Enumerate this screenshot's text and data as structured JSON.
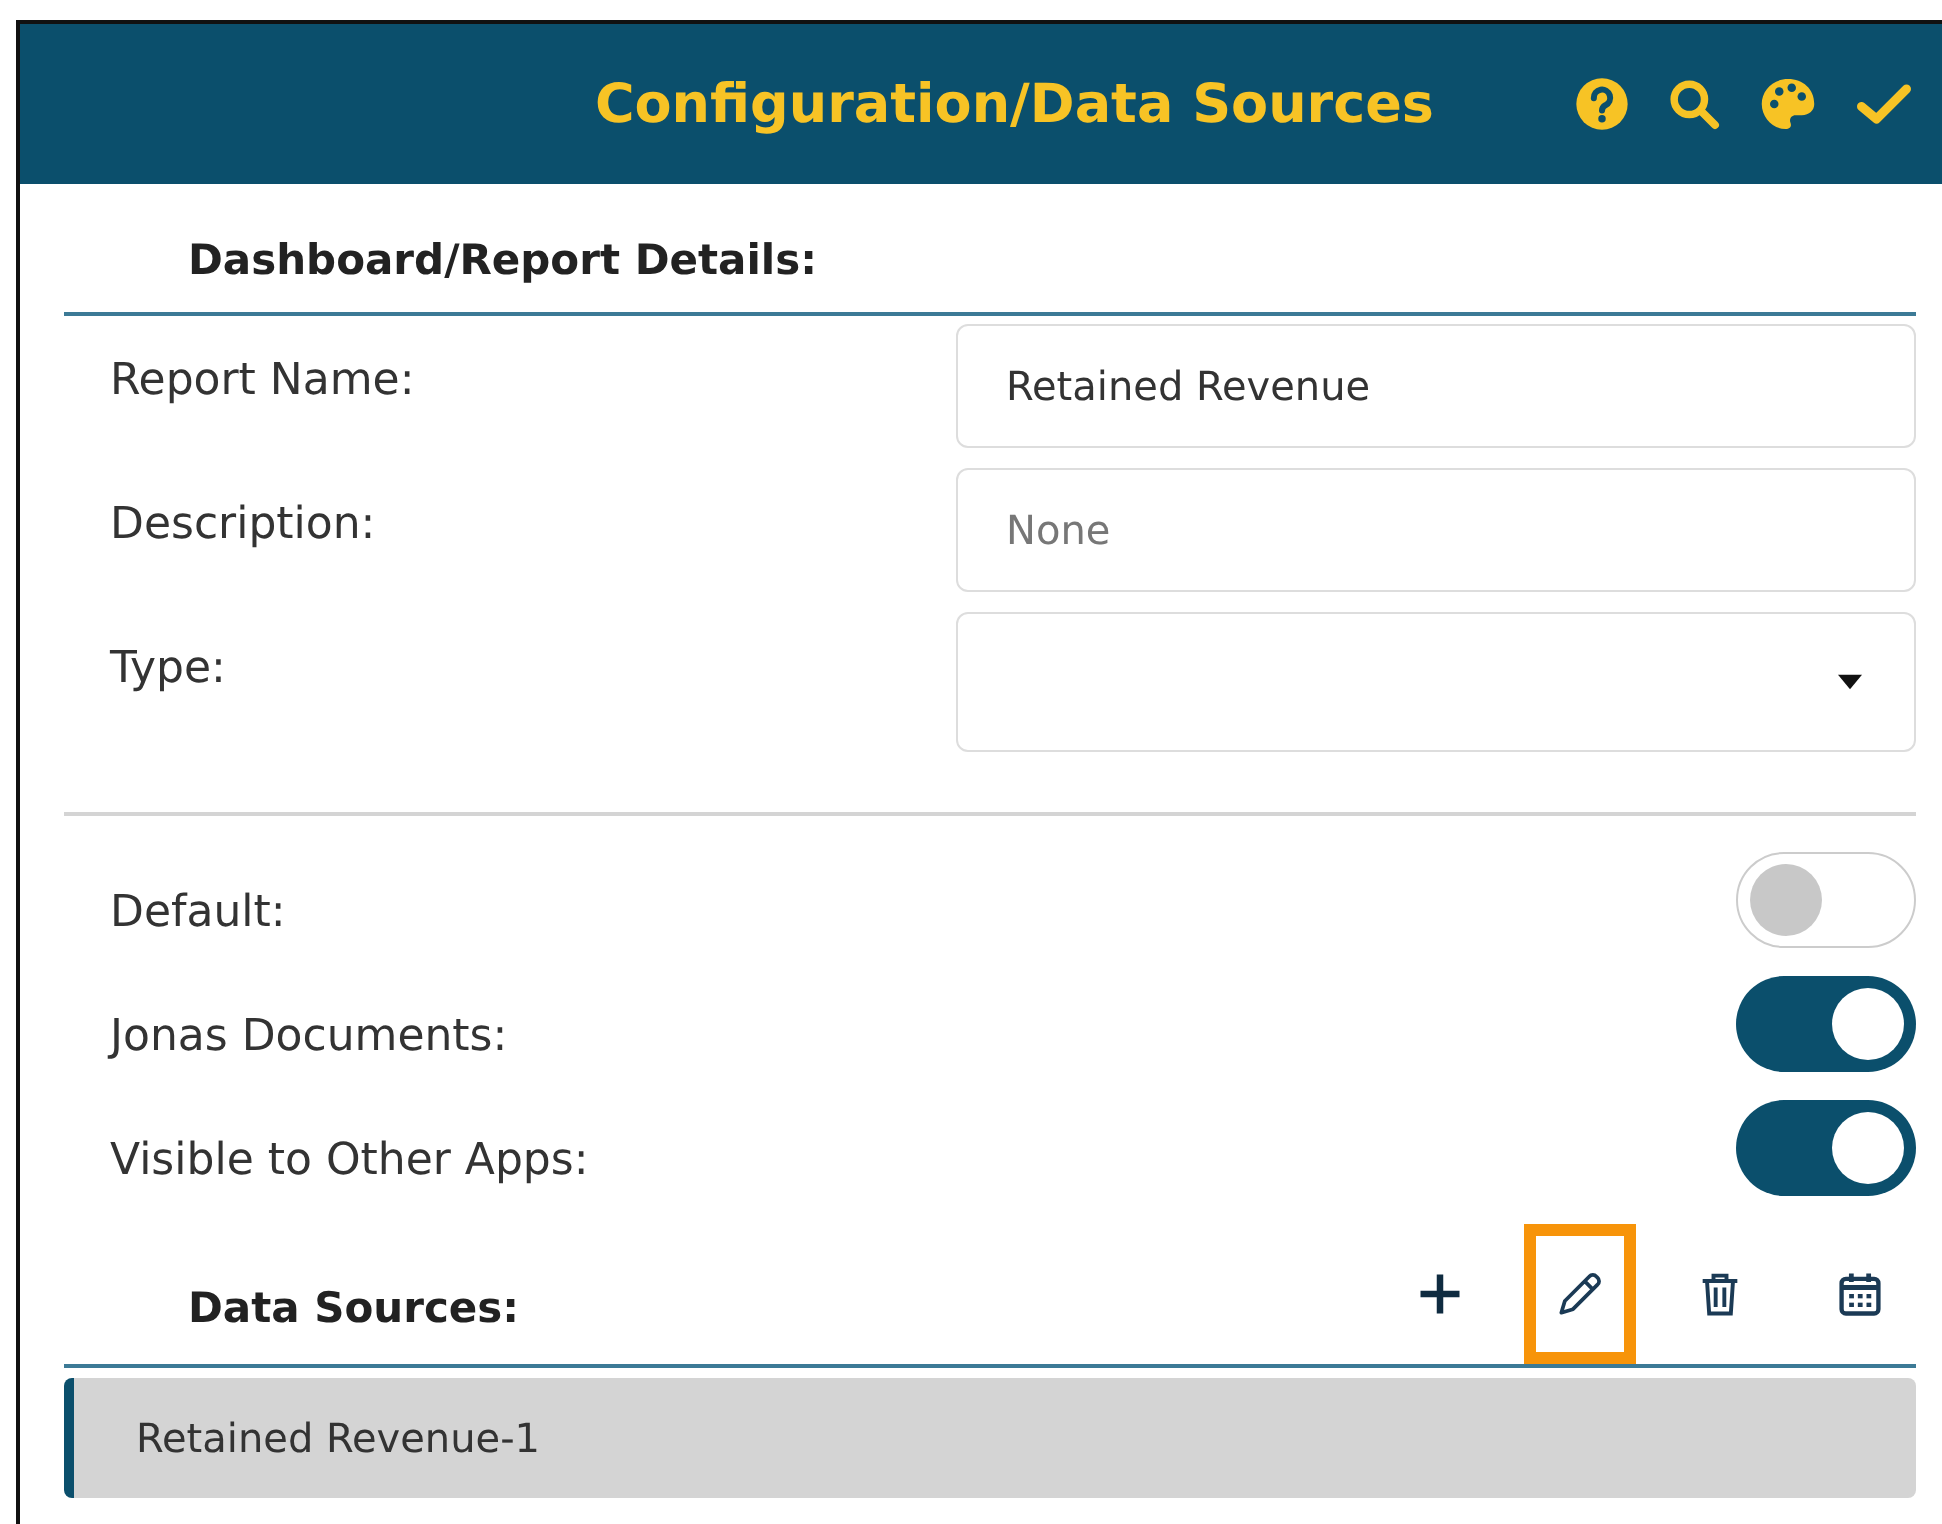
{
  "header": {
    "title": "Configuration/Data Sources",
    "actions": [
      {
        "kind": "help"
      },
      {
        "kind": "search"
      },
      {
        "kind": "palette"
      },
      {
        "kind": "check"
      }
    ]
  },
  "details": {
    "heading": "Dashboard/Report Details:",
    "fields": [
      {
        "label": "Report Name:",
        "kind": "text",
        "value": "Retained Revenue"
      },
      {
        "label": "Description:",
        "kind": "text",
        "placeholder": "None"
      },
      {
        "label": "Type:",
        "kind": "select"
      }
    ],
    "toggles": [
      {
        "label": "Default:",
        "on": false
      },
      {
        "label": "Jonas Documents:",
        "on": true
      },
      {
        "label": "Visible to Other Apps:",
        "on": true
      }
    ]
  },
  "data_sources": {
    "heading": "Data Sources:",
    "tools": [
      {
        "kind": "add",
        "highlighted": false
      },
      {
        "kind": "edit",
        "highlighted": true
      },
      {
        "kind": "delete",
        "highlighted": false
      },
      {
        "kind": "calendar",
        "highlighted": false
      }
    ],
    "items": [
      {
        "label": "Retained Revenue-1",
        "selected": true
      }
    ]
  }
}
